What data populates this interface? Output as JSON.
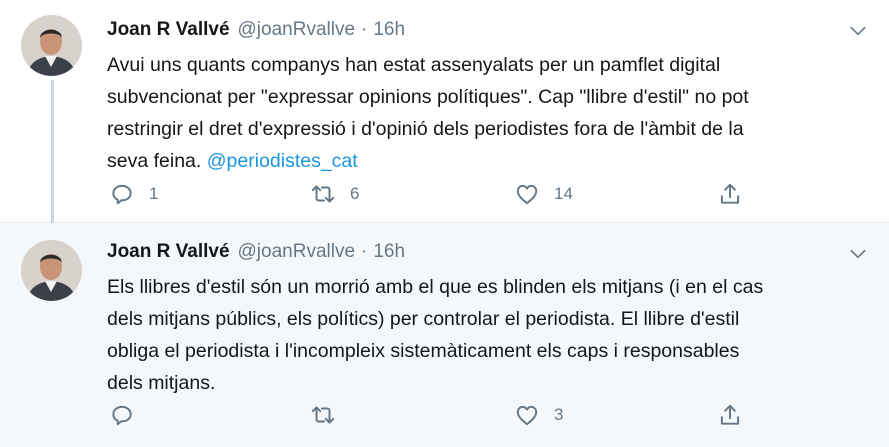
{
  "tweets": [
    {
      "author_name": "Joan R Vallvé",
      "handle": "@joanRvallve",
      "separator": "·",
      "time": "16h",
      "text_lines": [
        "Avui uns quants companys han estat assenyalats per un pamflet digital",
        "subvencionat per \"expressar opinions polítiques\". Cap \"llibre d'estil\" no pot",
        "restringir el dret d'expressió i d'opinió dels periodistes fora de l'àmbit de la",
        "seva feina. "
      ],
      "mention": "@periodistes_cat",
      "reply_count": "1",
      "retweet_count": "6",
      "like_count": "14"
    },
    {
      "author_name": "Joan R Vallvé",
      "handle": "@joanRvallve",
      "separator": "·",
      "time": "16h",
      "text_lines": [
        "Els llibres d'estil són un morrió amb el que es blinden els mitjans (i en el cas",
        "dels mitjans públics, els polítics) per controlar el periodista. El llibre d'estil",
        "obliga el periodista i l'incompleix sistemàticament els caps i responsables",
        "dels mitjans."
      ],
      "reply_count": "",
      "retweet_count": "",
      "like_count": "3"
    }
  ],
  "icons": [
    "reply-icon",
    "retweet-icon",
    "like-icon",
    "share-icon",
    "chevron-down-icon"
  ],
  "colors": {
    "text": "#14171a",
    "secondary": "#657786",
    "link": "#1b95e0",
    "highlight_bg": "#f5f8fa",
    "thread_line": "#ccd6dd"
  }
}
